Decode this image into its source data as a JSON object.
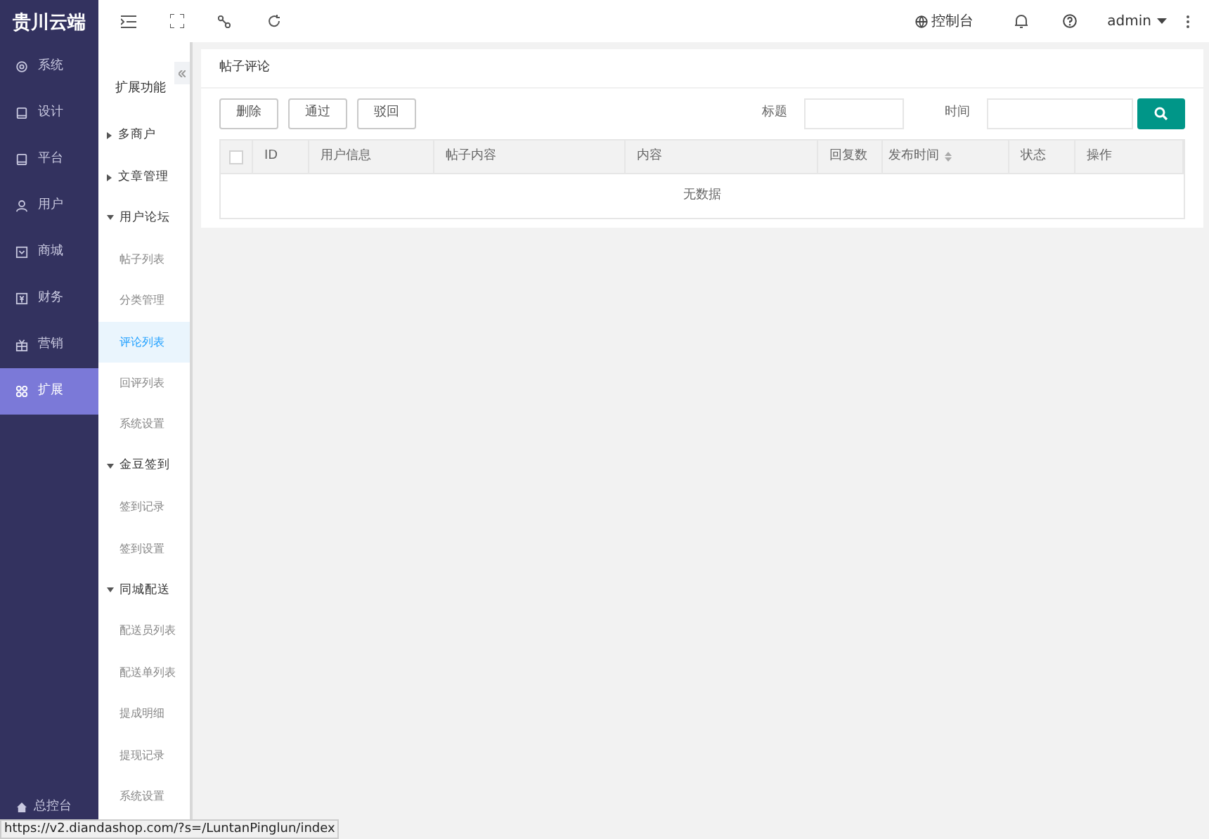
{
  "brand": "贵川云端",
  "nav": [
    {
      "label": "系统",
      "selected": false
    },
    {
      "label": "设计",
      "selected": false
    },
    {
      "label": "平台",
      "selected": false
    },
    {
      "label": "用户",
      "selected": false
    },
    {
      "label": "商城",
      "selected": false
    },
    {
      "label": "财务",
      "selected": false
    },
    {
      "label": "营销",
      "selected": false
    },
    {
      "label": "扩展",
      "selected": true
    }
  ],
  "nav_footer": "总控台",
  "submenu": {
    "title": "扩展功能",
    "groups": [
      {
        "label": "多商户",
        "expanded": false
      },
      {
        "label": "文章管理",
        "expanded": false
      },
      {
        "label": "用户论坛",
        "expanded": true,
        "children": [
          {
            "label": "帖子列表",
            "selected": false
          },
          {
            "label": "分类管理",
            "selected": false
          },
          {
            "label": "评论列表",
            "selected": true
          },
          {
            "label": "回评列表",
            "selected": false
          },
          {
            "label": "系统设置",
            "selected": false
          }
        ]
      },
      {
        "label": "金豆签到",
        "expanded": true,
        "children": [
          {
            "label": "签到记录",
            "selected": false
          },
          {
            "label": "签到设置",
            "selected": false
          }
        ]
      },
      {
        "label": "同城配送",
        "expanded": true,
        "children": [
          {
            "label": "配送员列表",
            "selected": false
          },
          {
            "label": "配送单列表",
            "selected": false
          },
          {
            "label": "提成明细",
            "selected": false
          },
          {
            "label": "提现记录",
            "selected": false
          },
          {
            "label": "系统设置",
            "selected": false
          }
        ]
      }
    ]
  },
  "topbar": {
    "console": "控制台",
    "user": "admin"
  },
  "card": {
    "title": "帖子评论",
    "buttons": [
      "删除",
      "通过",
      "驳回"
    ],
    "filters": [
      {
        "label": "标题"
      },
      {
        "label": "时间"
      }
    ],
    "table": {
      "select_all": {
        "checked": false
      },
      "columns": [
        {
          "label": "ID",
          "sortable": false
        },
        {
          "label": "用户信息",
          "sortable": false
        },
        {
          "label": "帖子内容",
          "sortable": false
        },
        {
          "label": "内容",
          "sortable": false
        },
        {
          "label": "回复数",
          "sortable": false
        },
        {
          "label": "发布时间",
          "sortable": true
        },
        {
          "label": "状态",
          "sortable": false
        },
        {
          "label": "操作",
          "sortable": false
        }
      ],
      "empty": "无数据"
    }
  },
  "status_url": "https://v2.diandashop.com/?s=/LuntanPinglun/index"
}
